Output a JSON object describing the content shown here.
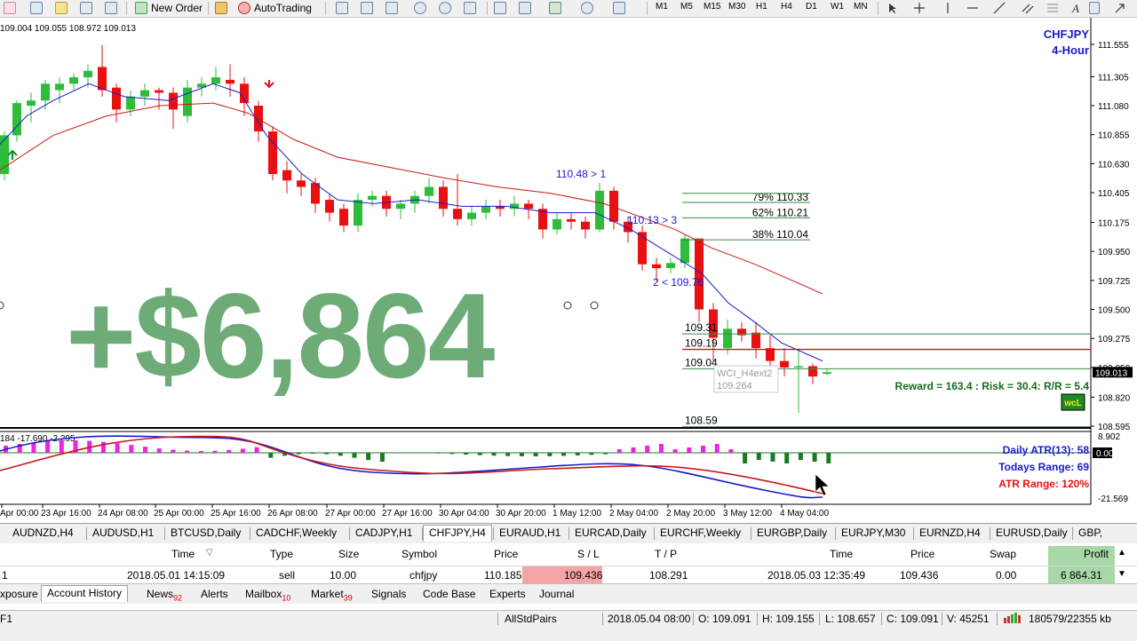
{
  "toolbar": {
    "new_order": "New Order",
    "auto_trading": "AutoTrading",
    "timeframes": [
      "M1",
      "M5",
      "M15",
      "M30",
      "H1",
      "H4",
      "D1",
      "W1",
      "MN"
    ]
  },
  "chart": {
    "ohlc_header": "109.004 109.055 108.972 109.013",
    "symbol": "CHFJPY",
    "timeframe": "4-Hour",
    "price_axis": [
      "111.555",
      "111.305",
      "111.080",
      "110.855",
      "110.630",
      "110.405",
      "110.175",
      "109.950",
      "109.725",
      "109.500",
      "109.275",
      "109.050",
      "108.820",
      "108.595"
    ],
    "current_price": "109.013",
    "fib_labels": [
      "79% 110.33",
      "62% 110.21",
      "38% 110.04"
    ],
    "annotations": {
      "a1": "110.48 > 1",
      "a2": "110.13 > 3",
      "a3": "2 < 109.76",
      "lvl1": "109.31",
      "lvl2": "109.19",
      "lvl3": "109.04",
      "lvl4": "108.59",
      "tooltip_name": "WCI_H4ext2",
      "tooltip_value": "109.264"
    },
    "reward_text": "Reward = 163.4 : Risk = 30.4: R/R = 5.4",
    "wcl_badge": "wcL",
    "profit_overlay": "+$6,864",
    "indicator": {
      "header": "184 -17.690 -2.295",
      "axis_top": "8.902",
      "axis_zero": "0.00",
      "axis_bottom": "-21.569",
      "daily_atr": "Daily ATR(13): 58",
      "todays_range": "Todays Range: 69",
      "atr_range": "ATR Range: 120%"
    },
    "time_axis": [
      "Apr 00:00",
      "23 Apr 16:00",
      "24 Apr 08:00",
      "25 Apr 00:00",
      "25 Apr 16:00",
      "26 Apr 08:00",
      "27 Apr 00:00",
      "27 Apr 16:00",
      "30 Apr 04:00",
      "30 Apr 20:00",
      "1 May 12:00",
      "2 May 04:00",
      "2 May 20:00",
      "3 May 12:00",
      "4 May 04:00"
    ],
    "colors": {
      "bull": "#2dbd3a",
      "bear": "#e81010",
      "ma_fast": "#1a1ad0",
      "ma_slow": "#c81818"
    }
  },
  "symbol_tabs": [
    "AUDNZD,H4",
    "AUDUSD,H1",
    "BTCUSD,Daily",
    "CADCHF,Weekly",
    "CADJPY,H1",
    "CHFJPY,H4",
    "EURAUD,H1",
    "EURCAD,Daily",
    "EURCHF,Weekly",
    "EURGBP,Daily",
    "EURJPY,M30",
    "EURNZD,H4",
    "EURUSD,Daily",
    "GBP,"
  ],
  "history": {
    "headers": [
      "Time",
      "Type",
      "Size",
      "Symbol",
      "Price",
      "S / L",
      "T / P",
      "Time",
      "Price",
      "Swap",
      "Profit"
    ],
    "row": {
      "id": "1",
      "open_time": "2018.05.01 14:15:09",
      "type": "sell",
      "size": "10.00",
      "symbol": "chfjpy",
      "price": "110.185",
      "sl": "109.436",
      "tp": "108.291",
      "close_time": "2018.05.03 12:35:49",
      "close_price": "109.436",
      "swap": "0.00",
      "profit": "6 864.31"
    }
  },
  "bottom_tabs": {
    "exposure": "xposure",
    "account_history": "Account History",
    "news": "News",
    "news_count": "92",
    "alerts": "Alerts",
    "mailbox": "Mailbox",
    "mailbox_count": "10",
    "market": "Market",
    "market_count": "39",
    "signals": "Signals",
    "code_base": "Code Base",
    "experts": "Experts",
    "journal": "Journal"
  },
  "status": {
    "profile": "AllStdPairs",
    "datetime": "2018.05.04 08:00",
    "open": "O: 109.091",
    "high": "H: 109.155",
    "low": "L: 108.657",
    "close": "C: 109.091",
    "volume": "V: 45251",
    "traffic": "180579/22355 kb",
    "left_f": "F1"
  }
}
